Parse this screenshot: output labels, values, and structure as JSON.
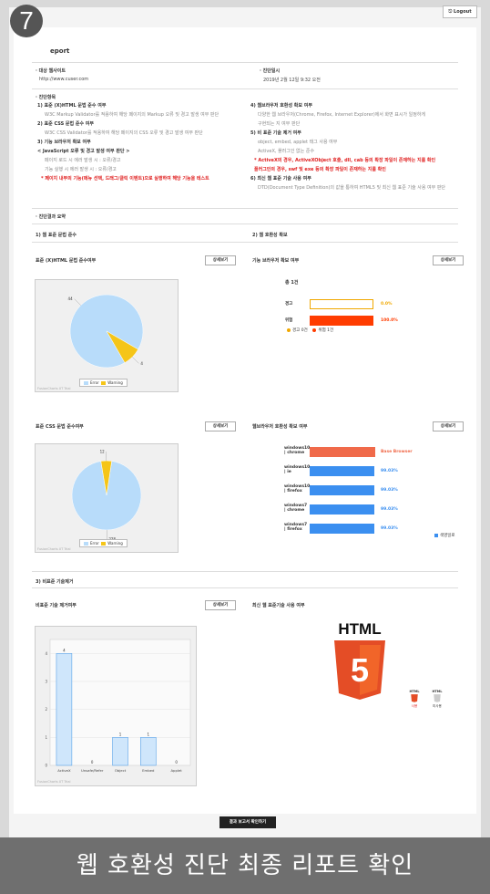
{
  "step_number": "7",
  "header": {
    "logout_label": "Logout",
    "title": "eport"
  },
  "info": {
    "site_label": "대상 웹사이트",
    "site_url": "http://www.cuser.com",
    "date_label": "진단일시",
    "date_value": "2019년 2월 12일 9:32 오전"
  },
  "criteria": {
    "title": "진단항목",
    "left": [
      {
        "text": "1) 표준 (X)HTML 문법 준수 여부",
        "style": "head"
      },
      {
        "text": "W3C Markup Validator를 적용하여 해당 페이지의 Markup 오류 및 경고 발생 여부 판단",
        "style": "gray"
      },
      {
        "text": "2) 표준 CSS 문법 준수 여부",
        "style": "head"
      },
      {
        "text": "W3C CSS Validator를 적용하여 해당 페이지의 CSS 오류 및 경고 발생 여부 판단",
        "style": "gray"
      },
      {
        "text": "3) 기능 브라우저 확보 여부",
        "style": "head"
      },
      {
        "text": "< JavaScript 오류 및 경고 발생 여부 판단 >",
        "style": "head"
      },
      {
        "text": "페이지 로드 시 에러 발생 시 : 오류/경고",
        "style": "gray"
      },
      {
        "text": "기능 실행 시 에러 발생 시 : 오류/경고",
        "style": "gray"
      },
      {
        "text": "* 페이지 내부의 기능(메뉴 선택, 드래그/클릭 이벤트)으로 실행하여 해당 기능을 테스트",
        "style": "red"
      }
    ],
    "right": [
      {
        "text": "4) 웹브라우저 호환성 확보 여부",
        "style": "head"
      },
      {
        "text": "다양한 웹 브라우저(Chrome, Firefox, Internet Explorer)에서 화면 표시가 일정하게",
        "style": "gray"
      },
      {
        "text": "구현되는 지 여부 판단",
        "style": "gray"
      },
      {
        "text": "5) 비 표준 기술 제거 여부",
        "style": "head"
      },
      {
        "text": "object, embed, applet 태그 사용 여부",
        "style": "gray"
      },
      {
        "text": "ActiveX, 플러그인 없는 준수",
        "style": "gray"
      },
      {
        "text": "* ActiveX의 경우, ActiveXObject 호출, dll, cab 등의 확장 파일이 존재하는 지를 확인",
        "style": "red"
      },
      {
        "text": "플러그인의 경우, swf 및 exe 등의 확장 파일이 존재하는 지를 확인",
        "style": "red"
      },
      {
        "text": "6) 최신 웹 표준 기술 사용 여부",
        "style": "head"
      },
      {
        "text": "DTD(Document Type Definition)의 값을 통하여 HTML5 및 최신 웹 표준 기술 사용 여부 판단",
        "style": "gray"
      }
    ]
  },
  "summary": {
    "title": "진단결과 요약"
  },
  "group1": {
    "left_title": "1) 웹 표준 문법 준수",
    "right_title": "2) 웹 호환성 확보"
  },
  "card_html": {
    "title": "표준 (X)HTML 문법 준수여부",
    "detail": "상세보기",
    "chart_data": {
      "type": "pie",
      "title": "",
      "series": [
        {
          "name": "Error",
          "value": 44,
          "color": "#b8dcfa"
        },
        {
          "name": "Warning",
          "value": 4,
          "color": "#f5c518"
        }
      ],
      "labels": [
        "44",
        "4"
      ]
    },
    "watermark": "FusionCharts XT Trial"
  },
  "card_js": {
    "title": "기능 브라우저 확보 여부",
    "detail": "상세보기",
    "total": "총 1건",
    "chart_data": {
      "type": "bar",
      "categories": [
        "경고",
        "위험"
      ],
      "values": [
        0,
        100
      ],
      "value_labels": [
        "0.0%",
        "100.0%"
      ],
      "colors": [
        "#f0a800",
        "#ff3c00"
      ]
    },
    "legend": [
      {
        "label": "경고 0건",
        "color": "#f0a800"
      },
      {
        "label": "위험 1건",
        "color": "#ff3c00"
      }
    ]
  },
  "card_css": {
    "title": "표준 CSS 문법 준수여부",
    "detail": "상세보기",
    "chart_data": {
      "type": "pie",
      "title": "",
      "series": [
        {
          "name": "Error",
          "value": 228,
          "color": "#b8dcfa"
        },
        {
          "name": "Warning",
          "value": 12,
          "color": "#f5c518"
        }
      ],
      "labels": [
        "228",
        "12"
      ]
    },
    "watermark": "FusionCharts XT Trial"
  },
  "card_browser": {
    "title": "웹브라우저 호환성 확보 여부",
    "detail": "상세보기",
    "chart_data": {
      "type": "bar",
      "categories": [
        "windows10 | chrome",
        "windows10 | ie",
        "windows10 | firefox",
        "windows7 | chrome",
        "windows7 | firefox"
      ],
      "values": [
        100,
        99.03,
        99.03,
        99.03,
        99.03
      ],
      "value_labels": [
        "Base Browser",
        "99.03%",
        "99.03%",
        "99.03%",
        "99.03%"
      ],
      "colors": [
        "#f06a4a",
        "#3b8ff0",
        "#3b8ff0",
        "#3b8ff0",
        "#3b8ff0"
      ]
    },
    "legend_label": "색영일로"
  },
  "group2": {
    "title": "3) 비표준 기술제거"
  },
  "card_nonstd": {
    "title": "비표준 기술 제거여부",
    "detail": "상세보기",
    "chart_data": {
      "type": "bar",
      "categories": [
        "ActiveX",
        "Unsafe/Refer",
        "Object",
        "Embed",
        "Applet"
      ],
      "values": [
        4,
        0,
        1,
        1,
        0
      ],
      "value_labels": [
        "4",
        "0",
        "1",
        "1",
        "0"
      ],
      "yticks": [
        "0",
        "1",
        "2",
        "3",
        "4"
      ],
      "ylim": [
        0,
        4.5
      ]
    },
    "watermark": "FusionCharts XT Trial"
  },
  "card_html5": {
    "title": "최신 웹 표준기술 사용 여부",
    "logo_text": "HTML",
    "logo_number": "5",
    "mini1_caption": "HTML",
    "mini1_sub": "사용",
    "mini2_caption": "HTML",
    "mini2_sub": "미사용"
  },
  "footer": {
    "button_label": "결과 보고서 확인하기",
    "caption": "웹 호환성 진단 최종 리포트 확인"
  }
}
